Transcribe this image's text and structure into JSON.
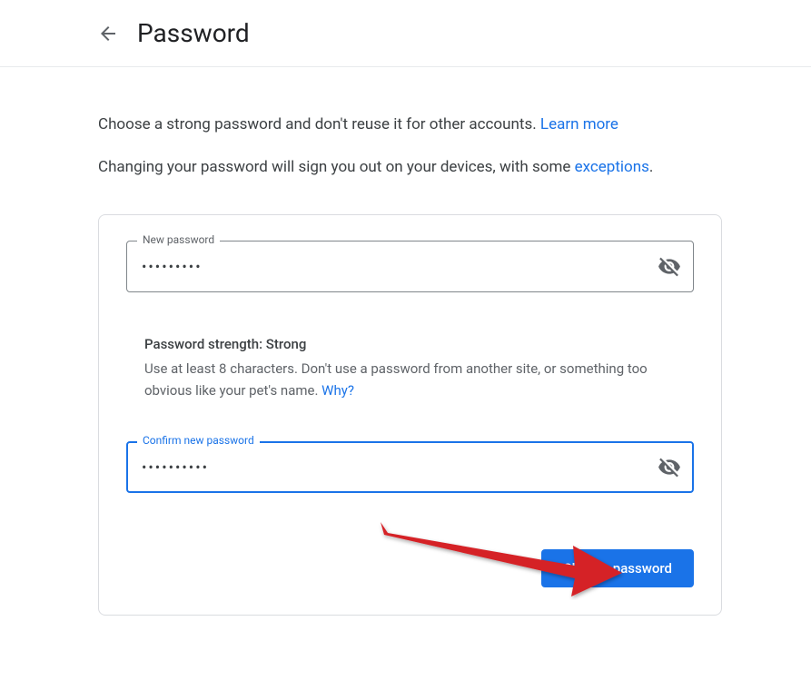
{
  "header": {
    "title": "Password"
  },
  "intro": {
    "line1_text": "Choose a strong password and don't reuse it for other accounts. ",
    "line1_link": "Learn more",
    "line2_text": "Changing your password will sign you out on your devices, with some ",
    "line2_link": "exceptions",
    "line2_after": "."
  },
  "form": {
    "new_password": {
      "label": "New password",
      "value": "•••••••••"
    },
    "strength": {
      "title": "Password strength: Strong",
      "desc_text": "Use at least 8 characters. Don't use a password from another site, or something too obvious like your pet's name. ",
      "desc_link": "Why?"
    },
    "confirm_password": {
      "label": "Confirm new password",
      "value": "••••••••••"
    },
    "submit_label": "Change password"
  }
}
